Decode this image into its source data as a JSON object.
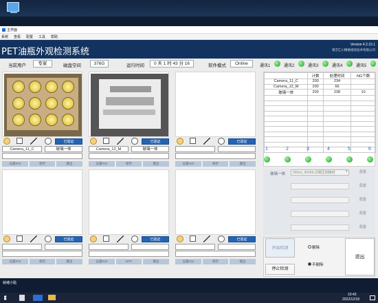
{
  "window": {
    "title": "主界面",
    "menu": [
      "系统",
      "查看",
      "配置",
      "工具",
      "帮助"
    ]
  },
  "header": {
    "title": "PET油瓶外观检测系统",
    "version": "Version 4.2.15.1",
    "company": "南京汇川精德视觉技术有限公司"
  },
  "info": {
    "user_label": "当前用户",
    "user": "专家",
    "disk_label": "磁盘空间",
    "disk": "376G",
    "runtime_label": "运行时间",
    "runtime": "0 天 1 时 43 分 16",
    "mode_label": "软件模式",
    "mode": "Online"
  },
  "comm": [
    "通讯1",
    "通讯2",
    "通讯3",
    "通讯4",
    "通讯5"
  ],
  "cameras": [
    {
      "name": "Camera_11_C",
      "product": "玻璃一体",
      "has_image": true,
      "verify": "已验证",
      "btns": [
        "设置ROI",
        "保存",
        "输出"
      ]
    },
    {
      "name": "Camera_12_M",
      "product": "玻璃一体",
      "has_image": true,
      "verify": "已验证",
      "btns": [
        "设置ROI",
        "保存",
        "输出"
      ]
    },
    {
      "name": "",
      "product": "",
      "has_image": false,
      "verify": "已验证",
      "btns": [
        "设置ROI",
        "保存",
        "输出"
      ]
    },
    {
      "name": "",
      "product": "",
      "has_image": false,
      "verify": "已验证",
      "btns": [
        "设置ROI",
        "保存",
        "输出"
      ]
    },
    {
      "name": "",
      "product": "",
      "has_image": false,
      "verify": "已验证",
      "btns": [
        "设置ROI",
        "MTP",
        "输出"
      ]
    },
    {
      "name": "",
      "product": "",
      "has_image": false,
      "verify": "已验证",
      "btns": [
        "设置ROI",
        "保存",
        "输出"
      ]
    }
  ],
  "stats": {
    "headers": [
      "",
      "计数",
      "处理时间",
      "NG个数"
    ],
    "rows": [
      [
        "Camera_11_C",
        "200",
        "234",
        ""
      ],
      [
        "Camera_12_M",
        "200",
        "66",
        ""
      ],
      [
        "玻璃一体",
        "200",
        "238",
        "10"
      ]
    ]
  },
  "channels": [
    "1",
    "2",
    "3",
    "4",
    "5",
    "6"
  ],
  "config": {
    "first": {
      "label": "玻璃一体",
      "value": "900ml_900ML详细压制精材",
      "button": "配置"
    },
    "button": "配置"
  },
  "controls": {
    "start": "开始检测",
    "stop": "停止检测",
    "opt1": "剔除",
    "opt2": "不剔除",
    "exit": "退出"
  },
  "status": "就绪小贴",
  "taskbar": {
    "time": "10:43",
    "date": "2022/12/18"
  },
  "colors": {
    "header": "#12335f",
    "led": "#1f9b1f",
    "verify": "#2364b5"
  }
}
